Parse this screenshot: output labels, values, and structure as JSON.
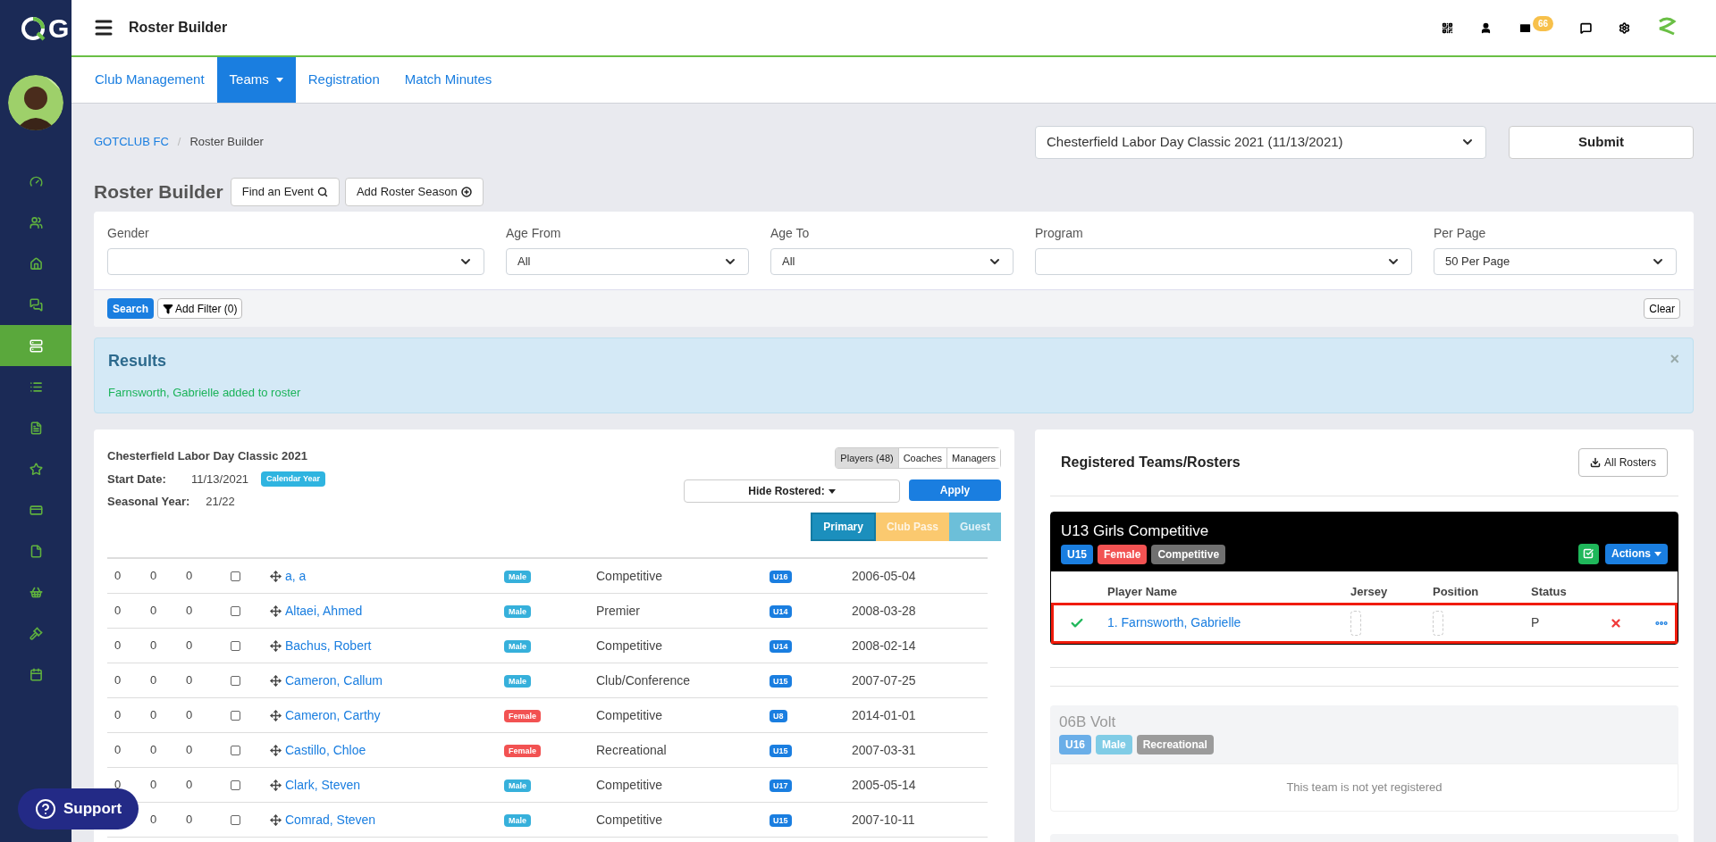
{
  "logo_text": "G",
  "sidebar": {
    "items": [
      {
        "kind": "gauge",
        "selected": false
      },
      {
        "kind": "users",
        "selected": false
      },
      {
        "kind": "home",
        "selected": false
      },
      {
        "kind": "chat",
        "selected": false
      },
      {
        "kind": "server",
        "selected": true
      },
      {
        "kind": "list",
        "selected": false
      },
      {
        "kind": "filetext",
        "selected": false
      },
      {
        "kind": "star",
        "selected": false
      },
      {
        "kind": "card",
        "selected": false
      },
      {
        "kind": "file",
        "selected": false
      },
      {
        "kind": "basket",
        "selected": false
      },
      {
        "kind": "gavel",
        "selected": false
      },
      {
        "kind": "calendar",
        "selected": false
      }
    ]
  },
  "topbar": {
    "title": "Roster Builder",
    "mail_badge": "66"
  },
  "nav": [
    {
      "label": "Club Management",
      "selected": false,
      "dropdown": false
    },
    {
      "label": "Teams",
      "selected": true,
      "dropdown": true
    },
    {
      "label": "Registration",
      "selected": false,
      "dropdown": false
    },
    {
      "label": "Match Minutes",
      "selected": false,
      "dropdown": false
    }
  ],
  "breadcrumb": [
    "GOTCLUB FC",
    "/",
    "Roster Builder"
  ],
  "event_select": "Chesterfield Labor Day Classic 2021 (11/13/2021)",
  "submit": "Submit",
  "heading": "Roster Builder",
  "heading_buttons": [
    {
      "label": "Find an Event",
      "kind": "search"
    },
    {
      "label": "Add Roster Season",
      "kind": "add"
    }
  ],
  "filters": [
    {
      "label": "Gender"
    },
    {
      "label": "Age From",
      "value": "All"
    },
    {
      "label": "Age To",
      "value": "All"
    },
    {
      "label": "Program"
    },
    {
      "label": "Per Page",
      "value": "50 Per Page"
    }
  ],
  "search_button": "Search",
  "add_filter": "Add Filter (0)",
  "clear": "Clear",
  "results": {
    "title": "Results",
    "message": "Farnsworth, Gabrielle added to roster",
    "close": "×"
  },
  "event": {
    "name": "Chesterfield Labor Day Classic 2021",
    "start_label": "Start Date:",
    "start": "11/13/2021",
    "year_badge": "Calendar Year",
    "season_label": "Seasonal Year:",
    "season": "21/22"
  },
  "roles": [
    {
      "label": "Players (48)",
      "selected": true
    },
    {
      "label": "Coaches",
      "selected": false
    },
    {
      "label": "Managers",
      "selected": false
    }
  ],
  "hide_rostered": "Hide Rostered:",
  "apply": "Apply",
  "pass_types": [
    {
      "label": "Primary",
      "selected": true,
      "color": "#1b8fbd"
    },
    {
      "label": "Club Pass",
      "selected": false,
      "color": "#fbc96f"
    },
    {
      "label": "Guest",
      "selected": false,
      "color": "#6cbfd9"
    }
  ],
  "players": [
    {
      "c1": "0",
      "c2": "0",
      "c3": "0",
      "checked": false,
      "name": "a, a",
      "gender": {
        "text": "Male",
        "color": "#36b0db"
      },
      "program": "Competitive",
      "age": "U16",
      "dob": "2006-05-04"
    },
    {
      "c1": "0",
      "c2": "0",
      "c3": "0",
      "checked": false,
      "name": "Altaei, Ahmed",
      "gender": {
        "text": "Male",
        "color": "#36b0db"
      },
      "program": "Premier",
      "age": "U14",
      "dob": "2008-03-28"
    },
    {
      "c1": "0",
      "c2": "0",
      "c3": "0",
      "checked": false,
      "name": "Bachus, Robert",
      "gender": {
        "text": "Male",
        "color": "#36b0db"
      },
      "program": "Competitive",
      "age": "U14",
      "dob": "2008-02-14"
    },
    {
      "c1": "0",
      "c2": "0",
      "c3": "0",
      "checked": false,
      "name": "Cameron, Callum",
      "gender": {
        "text": "Male",
        "color": "#36b0db"
      },
      "program": "Club/Conference",
      "age": "U15",
      "dob": "2007-07-25"
    },
    {
      "c1": "0",
      "c2": "0",
      "c3": "0",
      "checked": false,
      "name": "Cameron, Carthy",
      "gender": {
        "text": "Female",
        "color": "#f25252"
      },
      "program": "Competitive",
      "age": "U8",
      "dob": "2014-01-01"
    },
    {
      "c1": "0",
      "c2": "0",
      "c3": "0",
      "checked": false,
      "name": "Castillo, Chloe",
      "gender": {
        "text": "Female",
        "color": "#f25252"
      },
      "program": "Recreational",
      "age": "U15",
      "dob": "2007-03-31"
    },
    {
      "c1": "0",
      "c2": "0",
      "c3": "0",
      "checked": false,
      "name": "Clark, Steven",
      "gender": {
        "text": "Male",
        "color": "#36b0db"
      },
      "program": "Competitive",
      "age": "U17",
      "dob": "2005-05-14"
    },
    {
      "c2": "0",
      "c3": "0",
      "checked": false,
      "name": "Comrad, Steven",
      "gender": {
        "text": "Male",
        "color": "#36b0db"
      },
      "program": "Competitive",
      "age": "U15",
      "dob": "2007-10-11"
    }
  ],
  "support": "Support",
  "rosters": {
    "title": "Registered Teams/Rosters",
    "all_rosters": "All Rosters",
    "teams": [
      {
        "name": "U13 Girls Competitive",
        "registered": true,
        "tags": [
          {
            "text": "U15",
            "color": "#1a7ee0"
          },
          {
            "text": "Female",
            "color": "#f25252"
          },
          {
            "text": "Competitive",
            "color": "#707070"
          }
        ],
        "actions": "Actions",
        "columns": [
          "Player Name",
          "Jersey",
          "Position",
          "Status"
        ],
        "players": [
          {
            "name": "1. Farnsworth, Gabrielle",
            "status": "P",
            "approved": true,
            "highlighted": true
          }
        ]
      },
      {
        "name": "06B Volt",
        "registered": false,
        "tags": [
          {
            "text": "U16",
            "color": "#6aaee8"
          },
          {
            "text": "Male",
            "color": "#80cce6"
          },
          {
            "text": "Recreational",
            "color": "#9b9b9b"
          }
        ],
        "message": "This team is not yet registered"
      }
    ]
  }
}
